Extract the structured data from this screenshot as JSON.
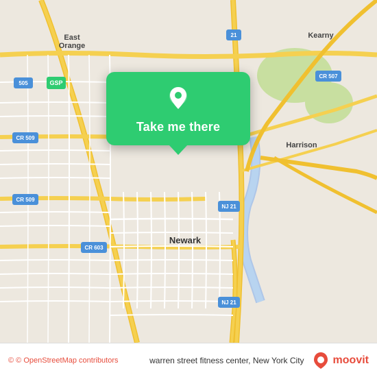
{
  "map": {
    "background_color": "#e8e0d8",
    "road_color_major": "#f5e6a0",
    "road_color_highway": "#f0d060",
    "road_color_minor": "#ffffff",
    "water_color": "#b0cfe8",
    "green_color": "#c8dfa0"
  },
  "popup": {
    "label": "Take me there",
    "bg_color": "#2ecc71",
    "pin_color": "#ffffff"
  },
  "bottom_bar": {
    "copyright": "© OpenStreetMap contributors",
    "location": "warren street fitness center, New York City",
    "logo_text": "moovit"
  },
  "labels": {
    "east_orange": "East\nOrange",
    "kearny": "Kearny",
    "harrison": "Harrison",
    "newark": "Newark",
    "gsp": "GSP",
    "cr509_top": "CR 509",
    "cr509_bot": "CR 509",
    "cr603": "CR 603",
    "nj21_top": "NJ 21",
    "nj21_bot": "NJ 21",
    "cr507": "CR 507",
    "route505": "505",
    "route21": "21"
  }
}
